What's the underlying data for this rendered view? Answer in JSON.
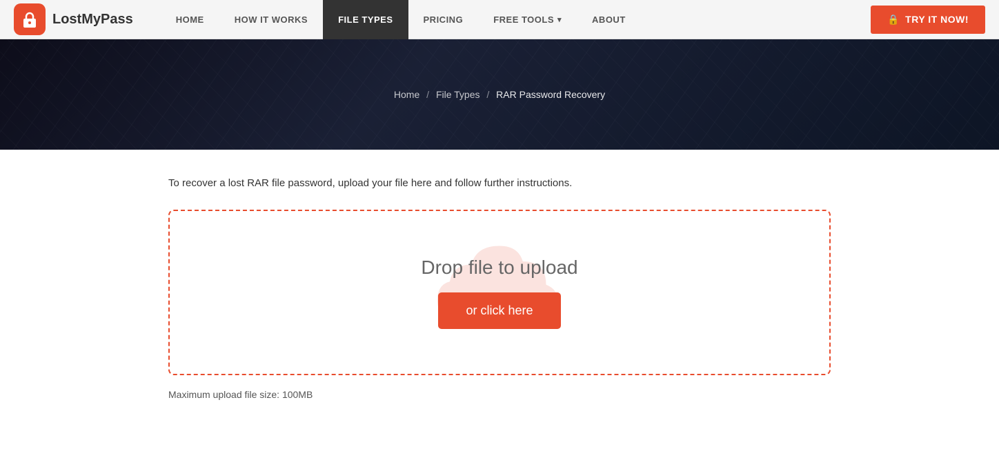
{
  "navbar": {
    "logo_text": "LostMyPass",
    "nav_items": [
      {
        "id": "home",
        "label": "HOME",
        "active": false,
        "has_dropdown": false
      },
      {
        "id": "how-it-works",
        "label": "HOW IT WORKS",
        "active": false,
        "has_dropdown": false
      },
      {
        "id": "file-types",
        "label": "FILE TYPES",
        "active": true,
        "has_dropdown": false
      },
      {
        "id": "pricing",
        "label": "PRICING",
        "active": false,
        "has_dropdown": false
      },
      {
        "id": "free-tools",
        "label": "FREE TOOLS",
        "active": false,
        "has_dropdown": true
      },
      {
        "id": "about",
        "label": "ABOUT",
        "active": false,
        "has_dropdown": false
      }
    ],
    "cta_label": "TRY IT NOW!"
  },
  "hero": {
    "breadcrumb": {
      "home": "Home",
      "separator1": "/",
      "file_types": "File Types",
      "separator2": "/",
      "current": "RAR Password Recovery"
    }
  },
  "main": {
    "description": "To recover a lost RAR file password, upload your file here and follow further instructions.",
    "upload_zone": {
      "drop_text": "Drop file to upload",
      "click_label": "or click here"
    },
    "file_size_note": "Maximum upload file size: 100MB"
  }
}
